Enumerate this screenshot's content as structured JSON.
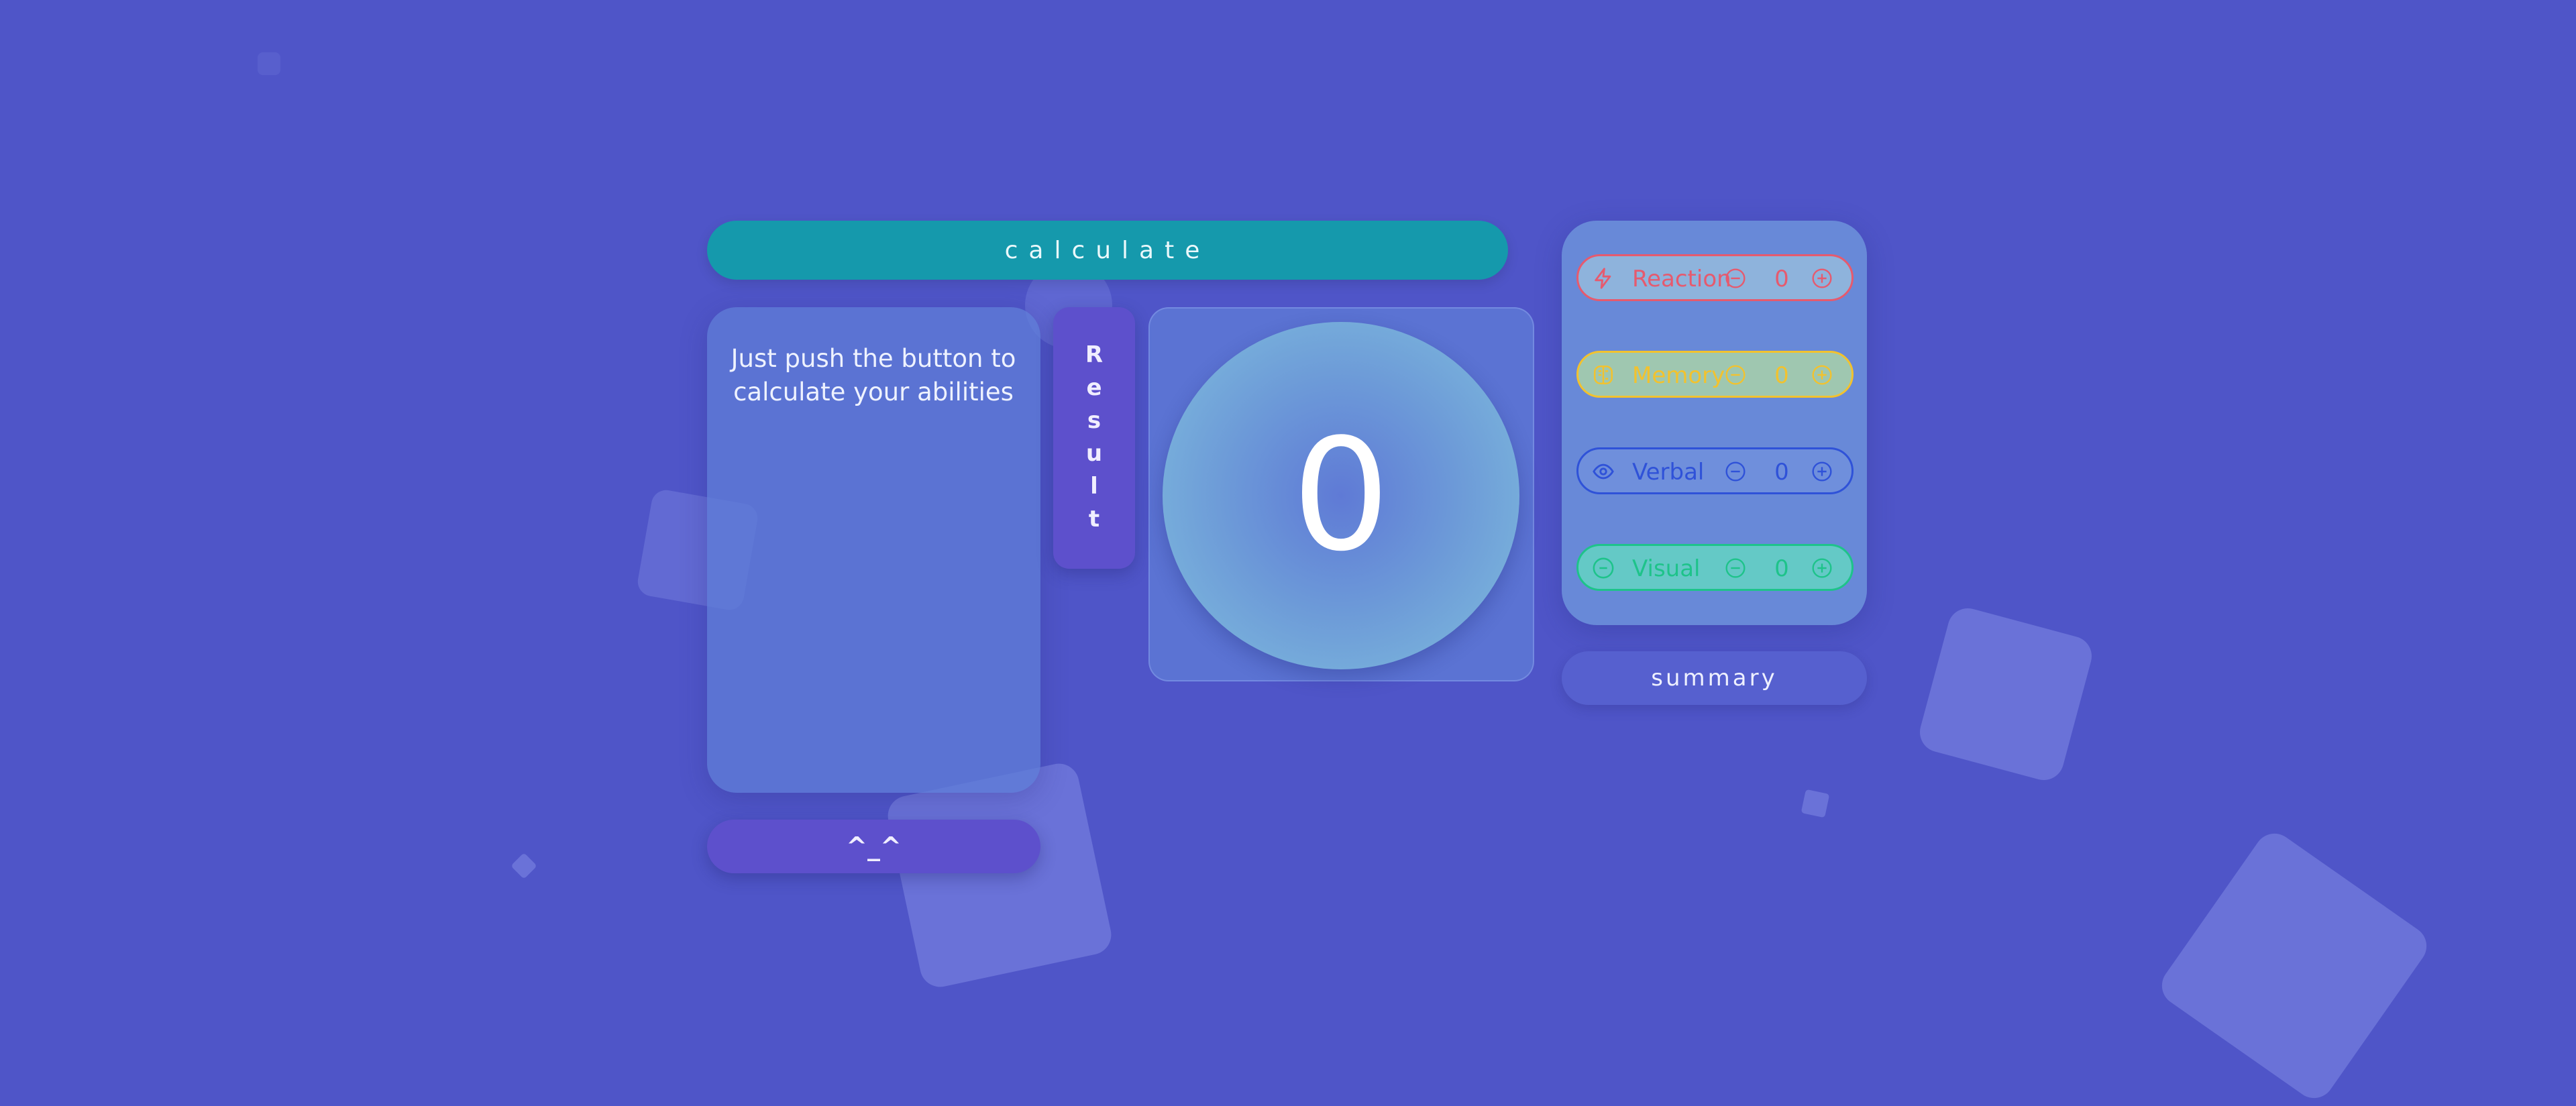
{
  "calculate_label": "calculate",
  "info_text": "Just push the button to calculate your abilities",
  "emoticon_label": "^_^",
  "result_letters": [
    "R",
    "e",
    "s",
    "u",
    "l",
    "t"
  ],
  "score": "0",
  "summary_label": "summary",
  "skills": [
    {
      "label": "Reaction",
      "value": "0",
      "icon": "lightning-icon",
      "color": "#e65a6e",
      "bg": "#8eb3dc"
    },
    {
      "label": "Memory",
      "value": "0",
      "icon": "brain-icon",
      "color": "#f2c22e",
      "bg": "#9fc7b0"
    },
    {
      "label": "Verbal",
      "value": "0",
      "icon": "eye-icon",
      "color": "#2f52d8",
      "bg": "#6f8fdc"
    },
    {
      "label": "Visual",
      "value": "0",
      "icon": "chat-icon",
      "color": "#1ec38a",
      "bg": "#64c9c6"
    }
  ]
}
